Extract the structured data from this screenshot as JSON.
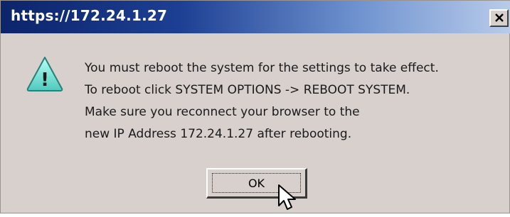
{
  "window": {
    "title": "https://172.24.1.27",
    "close_glyph": "✕"
  },
  "dialog": {
    "icon": "warning-icon",
    "icon_glyph": "!",
    "message_lines": [
      "You must reboot the system for the settings to take effect.",
      "To reboot click SYSTEM OPTIONS -> REBOOT SYSTEM.",
      "Make sure you reconnect your browser to the",
      "new IP Address 172.24.1.27 after rebooting."
    ],
    "ok_label": "OK"
  },
  "colors": {
    "titlebar_start": "#0c246a",
    "titlebar_end": "#b9cbea",
    "dialog_bg": "#d8d0cd",
    "icon_fill": "#7fe0d6"
  }
}
